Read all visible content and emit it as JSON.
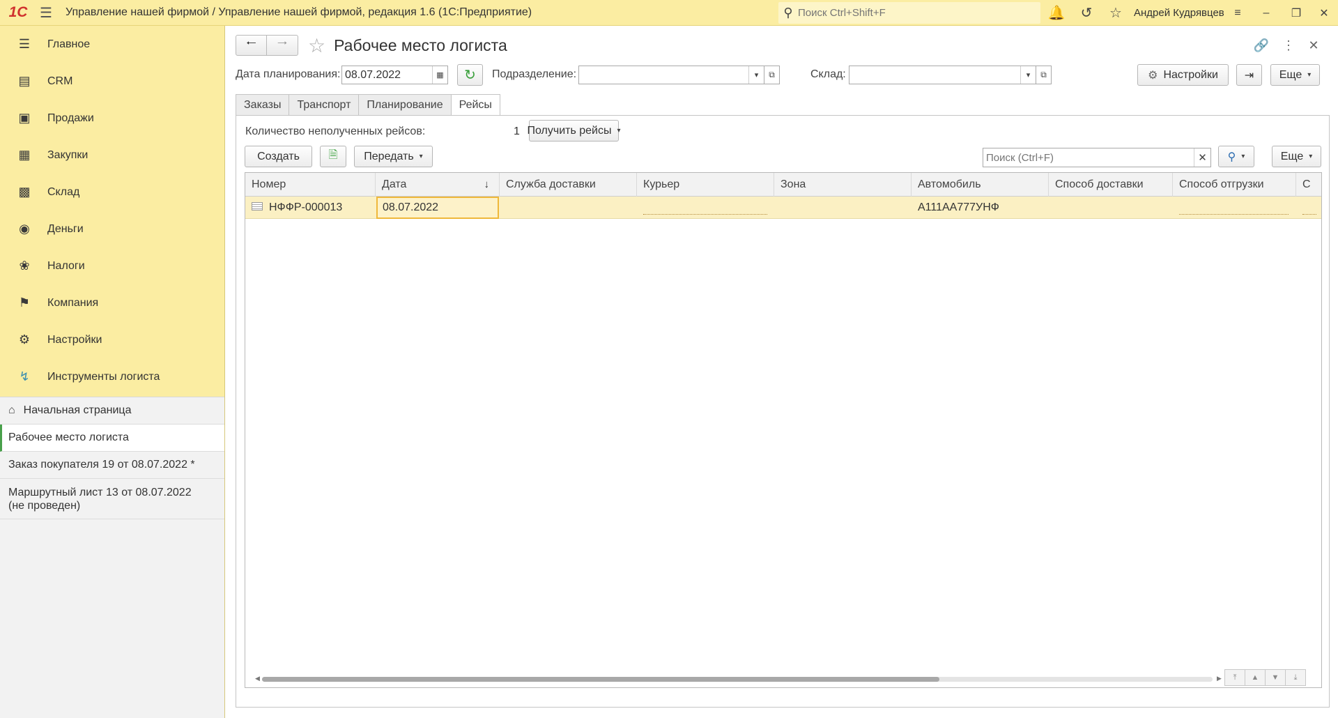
{
  "titlebar": {
    "logo": "1С",
    "title": "Управление нашей фирмой / Управление нашей фирмой, редакция 1.6  (1С:Предприятие)",
    "search_placeholder": "Поиск Ctrl+Shift+F",
    "user": "Андрей Кудрявцев"
  },
  "sidebar": {
    "items": [
      {
        "label": "Главное",
        "icon": "menu-lines-icon"
      },
      {
        "label": "CRM",
        "icon": "crm-icon"
      },
      {
        "label": "Продажи",
        "icon": "basket-icon"
      },
      {
        "label": "Закупки",
        "icon": "cart-icon"
      },
      {
        "label": "Склад",
        "icon": "warehouse-icon"
      },
      {
        "label": "Деньги",
        "icon": "money-icon"
      },
      {
        "label": "Налоги",
        "icon": "emblem-icon"
      },
      {
        "label": "Компания",
        "icon": "flag-icon"
      },
      {
        "label": "Настройки",
        "icon": "gear-icon"
      },
      {
        "label": "Инструменты логиста",
        "icon": "route-icon"
      }
    ],
    "open_windows": {
      "home": "Начальная страница",
      "active": "Рабочее место логиста",
      "order": "Заказ покупателя 19 от 08.07.2022 *",
      "route_line1": "Маршрутный лист 13 от 08.07.2022",
      "route_line2": "(не проведен)"
    }
  },
  "form": {
    "title": "Рабочее место логиста",
    "filters": {
      "date_label": "Дата планирования:",
      "date_value": "08.07.2022",
      "division_label": "Подразделение:",
      "division_value": "",
      "warehouse_label": "Склад:",
      "warehouse_value": "",
      "settings_btn": "Настройки",
      "more_btn": "Еще"
    },
    "tabs": [
      "Заказы",
      "Транспорт",
      "Планирование",
      "Рейсы"
    ],
    "active_tab": "Рейсы",
    "trips": {
      "count_label": "Количество неполученных рейсов:",
      "count_value": "1",
      "get_trips_btn": "Получить рейсы",
      "create_btn": "Создать",
      "transfer_btn": "Передать",
      "search_placeholder": "Поиск (Ctrl+F)",
      "more_btn": "Еще"
    },
    "table": {
      "columns": [
        "Номер",
        "Дата",
        "Служба доставки",
        "Курьер",
        "Зона",
        "Автомобиль",
        "Способ доставки",
        "Способ отгрузки",
        "С"
      ],
      "rows": [
        {
          "number": "НФФР-000013",
          "date": "08.07.2022",
          "delivery_service": "",
          "courier": "",
          "zone": "",
          "car": "А111АА777УНФ",
          "delivery_method": "",
          "shipment_method": "",
          "extra": ""
        }
      ]
    }
  }
}
